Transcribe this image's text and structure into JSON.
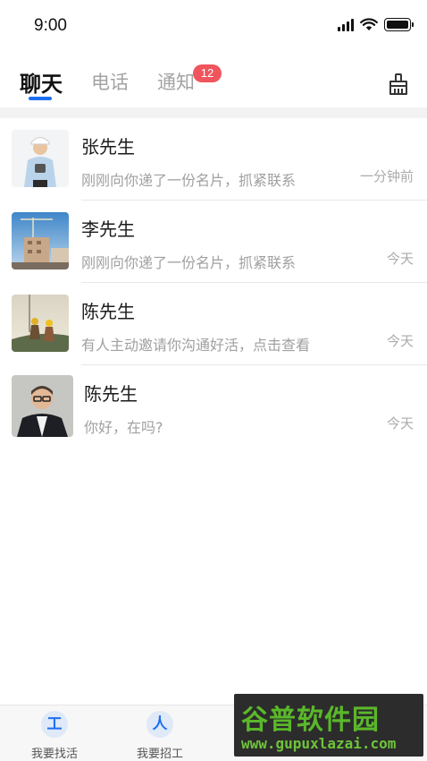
{
  "status_bar": {
    "time": "9:00"
  },
  "tabs": [
    {
      "label": "聊天"
    },
    {
      "label": "电话"
    },
    {
      "label": "通知",
      "badge": "12"
    }
  ],
  "chats": [
    {
      "name": "张先生",
      "message": "刚刚向你递了一份名片，抓紧联系",
      "time": "一分钟前"
    },
    {
      "name": "李先生",
      "message": "刚刚向你递了一份名片，抓紧联系",
      "time": "今天"
    },
    {
      "name": "陈先生",
      "message": "有人主动邀请你沟通好活，点击查看",
      "time": "今天"
    },
    {
      "name": "陈先生",
      "message": "你好，在吗?",
      "time": "今天"
    }
  ],
  "bottom_nav": [
    {
      "label": "我要找活",
      "icon_glyph": "工"
    },
    {
      "label": "我要招工",
      "icon_glyph": "人"
    }
  ],
  "watermark": {
    "title": "谷普软件园",
    "url": "www.gupuxlazai.com"
  },
  "colors": {
    "accent": "#1d6ff2",
    "badge": "#f0555d",
    "watermark_green": "#5ab82a"
  }
}
